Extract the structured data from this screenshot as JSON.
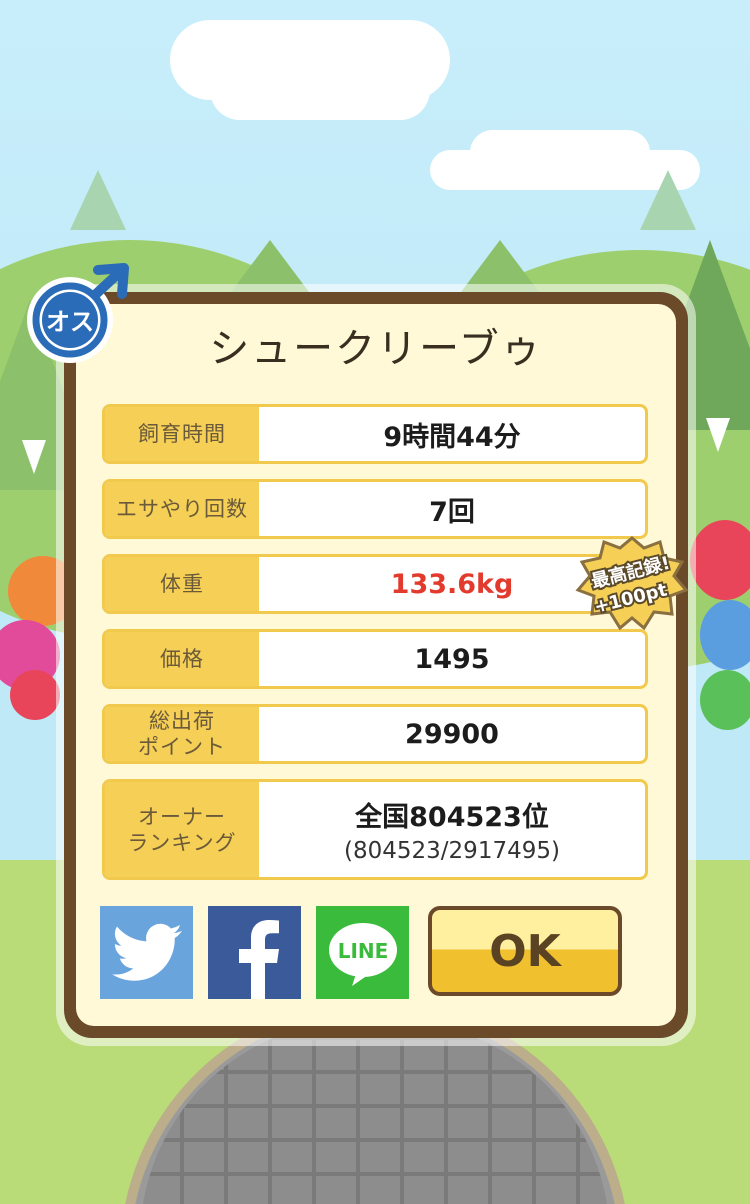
{
  "pet": {
    "name": "シュークリーブゥ",
    "gender_icon_text": "オス"
  },
  "stats": [
    {
      "label": "飼育時間",
      "value": "9時間44分"
    },
    {
      "label": "エサやり回数",
      "value": "7回"
    },
    {
      "label": "体重",
      "value": "133.6kg",
      "highlight": "#e23a2c"
    },
    {
      "label": "価格",
      "value": "1495"
    },
    {
      "label": "総出荷\nポイント",
      "value": "29900"
    },
    {
      "label": "オーナー\nランキング",
      "value": "全国804523位",
      "sub": "(804523/2917495)"
    }
  ],
  "badge": {
    "line1": "最高記録!",
    "line2": "+100pt"
  },
  "share": {
    "twitter_color": "#6aa4dc",
    "facebook_color": "#3b5a9a",
    "line_color": "#3bbb3b",
    "line_text": "LINE"
  },
  "ok_button": {
    "label": "OK"
  }
}
